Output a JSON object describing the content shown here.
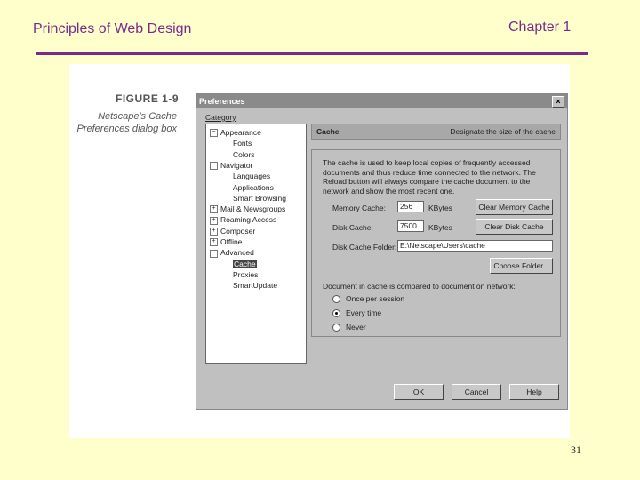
{
  "slide": {
    "title_left": "Principles of Web Design",
    "title_right": "Chapter 1",
    "page_number": "31"
  },
  "figure": {
    "label": "FIGURE 1-9",
    "caption_line1": "Netscape's Cache",
    "caption_line2": "Preferences dialog box"
  },
  "dialog": {
    "title": "Preferences",
    "close": "×",
    "category_label": "Category",
    "tree": [
      {
        "label": "Appearance",
        "level": 0,
        "expander": "−"
      },
      {
        "label": "Fonts",
        "level": 1
      },
      {
        "label": "Colors",
        "level": 1
      },
      {
        "label": "Navigator",
        "level": 0,
        "expander": "−"
      },
      {
        "label": "Languages",
        "level": 1
      },
      {
        "label": "Applications",
        "level": 1
      },
      {
        "label": "Smart Browsing",
        "level": 1
      },
      {
        "label": "Mail & Newsgroups",
        "level": 0,
        "expander": "+"
      },
      {
        "label": "Roaming Access",
        "level": 0,
        "expander": "+"
      },
      {
        "label": "Composer",
        "level": 0,
        "expander": "+"
      },
      {
        "label": "Offline",
        "level": 0,
        "expander": "+"
      },
      {
        "label": "Advanced",
        "level": 0,
        "expander": "−"
      },
      {
        "label": "Cache",
        "level": 1,
        "selected": true
      },
      {
        "label": "Proxies",
        "level": 1
      },
      {
        "label": "SmartUpdate",
        "level": 1
      }
    ],
    "panel": {
      "title": "Cache",
      "description": "Designate the size of the cache",
      "info_text": "The cache is used to keep local copies of frequently accessed documents and thus reduce time connected to the network. The Reload button will always compare the cache document to the network and show the most recent one.",
      "memory_cache_label": "Memory Cache:",
      "memory_cache_value": "256",
      "memory_unit": "KBytes",
      "disk_cache_label": "Disk Cache:",
      "disk_cache_value": "7500",
      "disk_unit": "KBytes",
      "clear_memory_button": "Clear Memory Cache",
      "clear_disk_button": "Clear Disk Cache",
      "folder_label": "Disk Cache Folder:",
      "folder_value": "E:\\Netscape\\Users\\cache",
      "choose_folder_button": "Choose Folder...",
      "compare_label": "Document in cache is compared to document on network:",
      "options": [
        {
          "label": "Once per session",
          "checked": false
        },
        {
          "label": "Every time",
          "checked": true
        },
        {
          "label": "Never",
          "checked": false
        }
      ]
    },
    "buttons": {
      "ok": "OK",
      "cancel": "Cancel",
      "help": "Help"
    }
  }
}
